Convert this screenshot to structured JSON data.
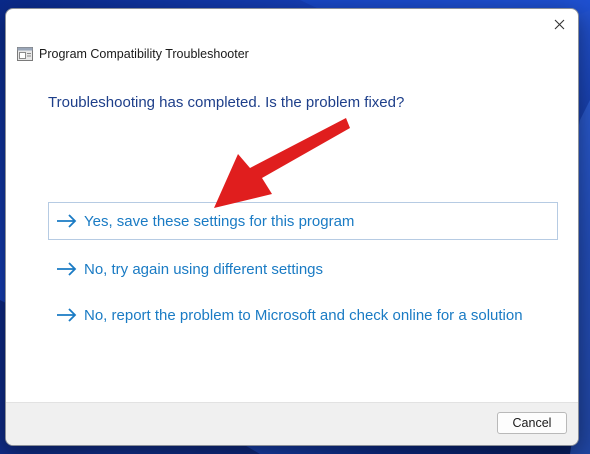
{
  "window": {
    "title": "Program Compatibility Troubleshooter",
    "icon": "troubleshooter-app-icon"
  },
  "content": {
    "question": "Troubleshooting has completed.  Is the problem fixed?"
  },
  "options": [
    {
      "label": "Yes, save these settings for this program",
      "icon": "arrow-right-icon",
      "selected": true
    },
    {
      "label": "No, try again using different settings",
      "icon": "arrow-right-icon",
      "selected": false
    },
    {
      "label": "No, report the problem to Microsoft and check online for a solution",
      "icon": "arrow-right-icon",
      "selected": false
    }
  ],
  "footer": {
    "cancel_label": "Cancel"
  },
  "colors": {
    "question_text": "#1e3f8a",
    "option_text": "#1a7bc4",
    "annotation_arrow": "#e01e1e",
    "footer_bg": "#f0f0f0"
  }
}
